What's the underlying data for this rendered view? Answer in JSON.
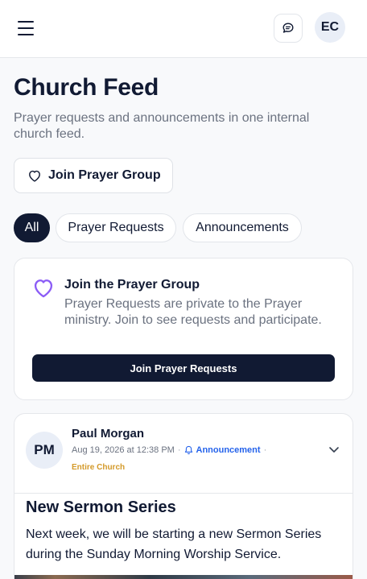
{
  "header": {
    "menu_icon": "hamburger-icon",
    "chat_icon": "chat-bubble-icon",
    "avatar_initials": "EC"
  },
  "page": {
    "title": "Church Feed",
    "subtitle": "Prayer requests and announcements in one internal church feed.",
    "join_button_label": "Join Prayer Group",
    "join_button_icon": "heart-icon"
  },
  "tabs": [
    {
      "label": "All",
      "active": true
    },
    {
      "label": "Prayer Requests",
      "active": false
    },
    {
      "label": "Announcements",
      "active": false
    }
  ],
  "join_card": {
    "icon": "heart-icon",
    "title": "Join the Prayer Group",
    "text": "Prayer Requests are private to the Prayer ministry. Join to see requests and participate.",
    "button_label": "Join Prayer Requests"
  },
  "post": {
    "avatar_initials": "PM",
    "author": "Paul Morgan",
    "timestamp": "Aug 19, 2026 at 12:38 PM",
    "type_label": "Announcement",
    "type_icon": "bell-icon",
    "audience": "Entire Church",
    "title": "New Sermon Series",
    "body": "Next week, we will be starting a new Sermon Series during the Sunday Morning Worship Service."
  },
  "colors": {
    "primary": "#111a33",
    "muted_text": "#6b7280",
    "accent_purple": "#8b5cf6",
    "announcement_blue": "#2563eb",
    "audience_gold": "#d49a2a"
  }
}
